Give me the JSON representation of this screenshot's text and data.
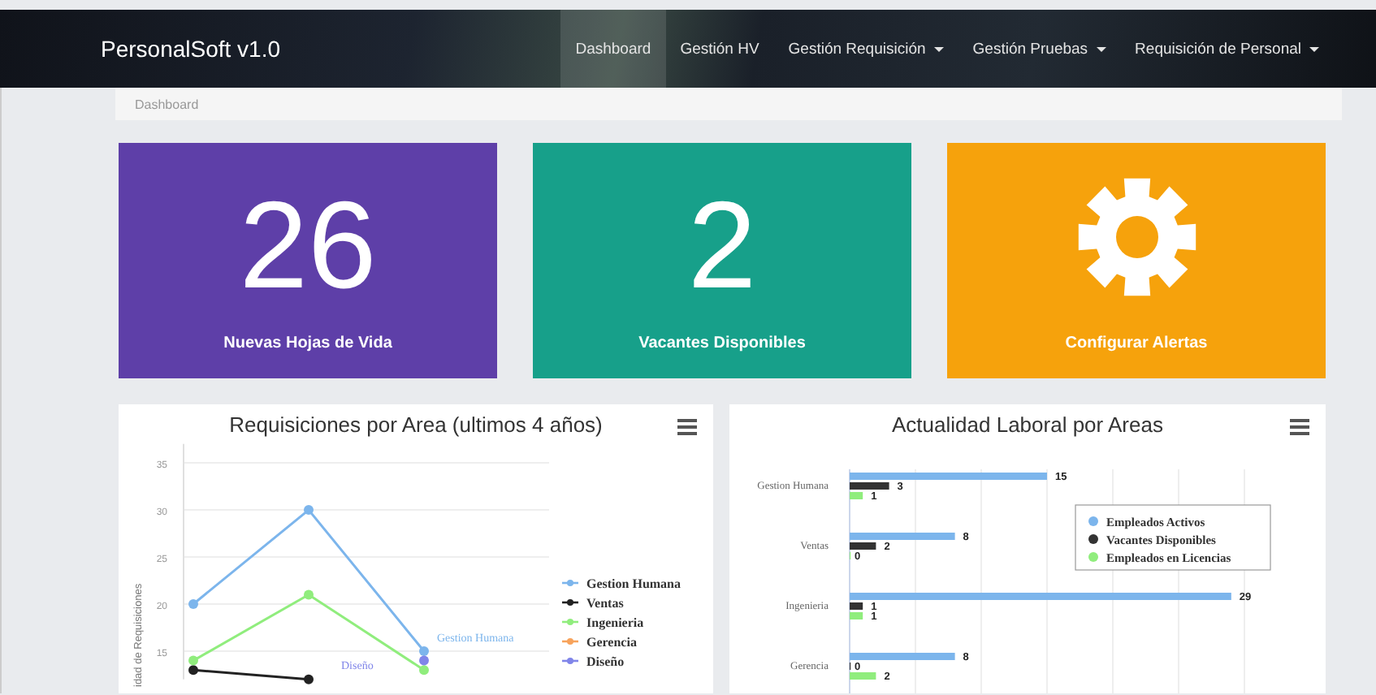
{
  "navbar": {
    "brand": "PersonalSoft v1.0",
    "items": [
      {
        "label": "Dashboard",
        "selected": true,
        "dropdown": false
      },
      {
        "label": "Gestión HV",
        "selected": false,
        "dropdown": false
      },
      {
        "label": "Gestión Requisición",
        "selected": false,
        "dropdown": true
      },
      {
        "label": "Gestión Pruebas",
        "selected": false,
        "dropdown": true
      },
      {
        "label": "Requisición de Personal",
        "selected": false,
        "dropdown": true
      }
    ]
  },
  "breadcrumb": [
    "Dashboard"
  ],
  "cards": [
    {
      "kind": "count",
      "value": "26",
      "label": "Nuevas Hojas de Vida",
      "color": "#5e3fa8"
    },
    {
      "kind": "count",
      "value": "2",
      "label": "Vacantes Disponibles",
      "color": "#17a08a"
    },
    {
      "kind": "icon",
      "label": "Configurar Alertas",
      "color": "#f6a20c"
    }
  ],
  "charts": [
    {
      "chart_data": {
        "type": "line",
        "title": "Requisiciones por Area (ultimos 4 años)",
        "ylabel": "idad de Requisiciones",
        "ylim": [
          12,
          37
        ],
        "yticks": [
          15,
          20,
          25,
          30,
          35
        ],
        "grid": true,
        "legend": "right",
        "series": [
          {
            "name": "Gestion Humana",
            "color": "#7cb5ec",
            "marker": "circle",
            "values": [
              20,
              30,
              15
            ]
          },
          {
            "name": "Ventas",
            "color": "#222222",
            "marker": "circle",
            "values": [
              13,
              12,
              null
            ]
          },
          {
            "name": "Ingenieria",
            "color": "#90ed7d",
            "marker": "circle",
            "values": [
              14,
              21,
              13
            ]
          },
          {
            "name": "Gerencia",
            "color": "#f7a35c",
            "marker": "circle",
            "values": [
              null,
              null,
              null
            ]
          },
          {
            "name": "Diseño",
            "color": "#8085e9",
            "marker": "circle",
            "values": [
              null,
              null,
              14
            ]
          }
        ],
        "annotations": [
          "Gestion Humana",
          "Diseño"
        ]
      }
    },
    {
      "chart_data": {
        "type": "bar",
        "orientation": "horizontal",
        "title": "Actualidad Laboral por Areas",
        "categories": [
          "Gestion Humana",
          "Ventas",
          "Ingenieria",
          "Gerencia"
        ],
        "grid": true,
        "legend": "upper right",
        "data_labels": true,
        "series": [
          {
            "name": "Empleados Activos",
            "color": "#7cb5ec",
            "values": [
              15,
              8,
              29,
              8
            ]
          },
          {
            "name": "Vacantes Disponibles",
            "color": "#333333",
            "values": [
              3,
              2,
              1,
              0
            ]
          },
          {
            "name": "Empleados en Licencias",
            "color": "#90ed7d",
            "values": [
              1,
              0,
              1,
              2
            ]
          }
        ]
      }
    }
  ]
}
